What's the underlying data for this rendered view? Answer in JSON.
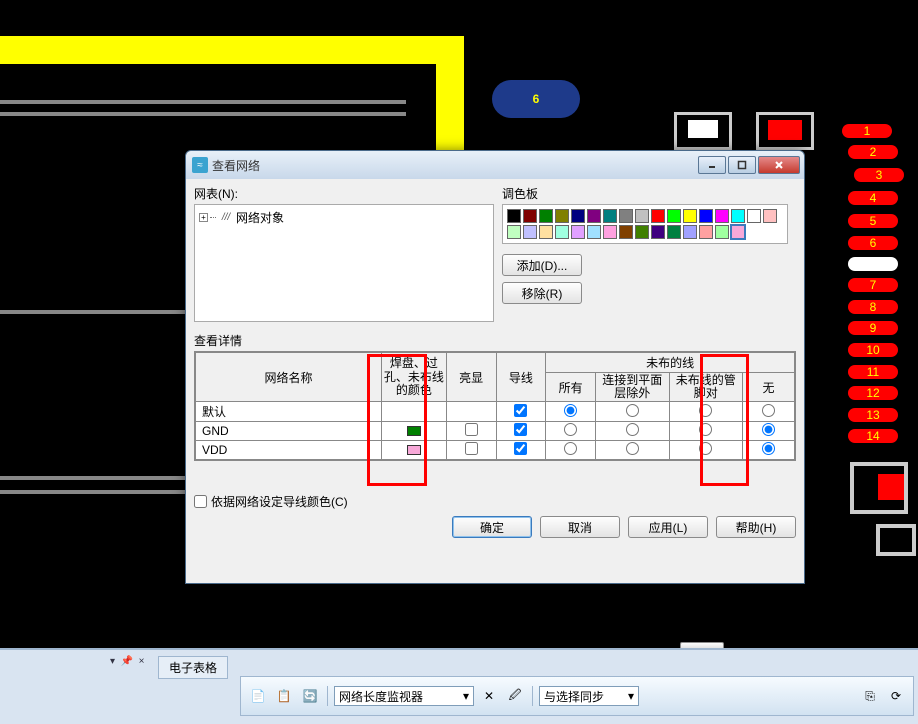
{
  "canvas": {
    "marker_label": "6",
    "net_tags": [
      "1",
      "2",
      "3",
      "4",
      "5",
      "6",
      "7",
      "8",
      "9",
      "10",
      "11",
      "12",
      "13",
      "14"
    ]
  },
  "dialog": {
    "title": "查看网络",
    "netlist_label": "网表(N):",
    "tree_root": "网络对象",
    "palette_label": "调色板",
    "palette_colors": [
      "#000000",
      "#800000",
      "#008000",
      "#808000",
      "#000080",
      "#800080",
      "#008080",
      "#808080",
      "#c0c0c0",
      "#ff0000",
      "#00ff00",
      "#ffff00",
      "#0000ff",
      "#ff00ff",
      "#00ffff",
      "#ffffff",
      "#ffc0c0",
      "#c0ffc0",
      "#c0c0ff",
      "#ffe0a0",
      "#a0ffe0",
      "#e0a0ff",
      "#a0e0ff",
      "#ffa0e0",
      "#804000",
      "#408000",
      "#400080",
      "#008040",
      "#a0a0ff",
      "#ffa0a0",
      "#a0ffa0",
      "#f7a8d8"
    ],
    "selected_swatch_index": 31,
    "add_btn": "添加(D)...",
    "remove_btn": "移除(R)",
    "detail_label": "查看详情",
    "headers": {
      "name": "网络名称",
      "color": "焊盘、过孔、未布线的颜色",
      "highlight": "亮显",
      "wire": "导线",
      "unrouted_group": "未布的线",
      "all": "所有",
      "except_plane": "连接到平面层除外",
      "unrouted_pair": "未布线的管脚对",
      "none": "无"
    },
    "rows": [
      {
        "name": "默认",
        "color": null,
        "highlight": false,
        "wire": true,
        "radio": "all",
        "show_highlight_cb": false
      },
      {
        "name": "GND",
        "color": "#008000",
        "highlight": false,
        "wire": true,
        "radio": "none",
        "show_highlight_cb": true
      },
      {
        "name": "VDD",
        "color": "#f7a8d8",
        "highlight": false,
        "wire": true,
        "radio": "none",
        "show_highlight_cb": true
      }
    ],
    "set_wire_color_cb_label": "依据网络设定导线颜色(C)",
    "set_wire_color_cb": false,
    "ok": "确定",
    "cancel": "取消",
    "apply": "应用(L)",
    "help": "帮助(H)"
  },
  "bottom": {
    "spreadsheet_tab": "电子表格",
    "net_length_monitor": "网络长度监视器",
    "sync_select": "与选择同步"
  }
}
